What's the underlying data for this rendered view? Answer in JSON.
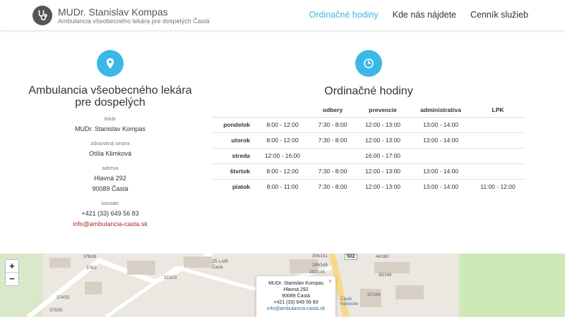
{
  "header": {
    "title": "MUDr. Stanislav Kompas",
    "subtitle": "Ambulancia všeobecného lekára pre dospelých Častá",
    "nav": [
      {
        "label": "Ordinačné hodiny",
        "active": true
      },
      {
        "label": "Kde nás nájdete",
        "active": false
      },
      {
        "label": "Cenník služieb",
        "active": false
      }
    ]
  },
  "colors": {
    "accent": "#3bb7e8",
    "email": "#b02a2a"
  },
  "icons": {
    "logo": "stethoscope-icon",
    "left": "map-marker-icon",
    "right": "clock-icon"
  },
  "contact": {
    "heading": "Ambulancia všeobecného lekára pre dospelých",
    "doctor_label": "lekár",
    "doctor": "MUDr. Stanislav Kompas",
    "nurse_label": "zdravotná sestra",
    "nurse": "Otília Klimková",
    "address_label": "adresa",
    "street": "Hlavná 292",
    "city": "90089 Častá",
    "contact_label": "kontakt",
    "phone": "+421 (33) 649 56 83",
    "email": "info@ambulancia-casta.sk"
  },
  "hours": {
    "title": "Ordinačné hodiny",
    "columns": [
      "",
      "",
      "odbery",
      "prevencie",
      "administratíva",
      "LPK"
    ],
    "rows": [
      {
        "day": "pondelok",
        "cells": [
          "8:00 - 12:00",
          "7:30 - 8:00",
          "12:00 - 13:00",
          "13:00 - 14:00",
          ""
        ]
      },
      {
        "day": "utorok",
        "cells": [
          "8:00 - 12:00",
          "7:30 - 8:00",
          "12:00 - 13:00",
          "13:00 - 14:00",
          ""
        ]
      },
      {
        "day": "streda",
        "cells": [
          "12:00 - 16:00",
          "",
          "16:00 - 17:00",
          "",
          ""
        ]
      },
      {
        "day": "štvrtok",
        "cells": [
          "8:00 - 12:00",
          "7:30 - 8:00",
          "12:00 - 13:00",
          "13:00 - 14:00",
          ""
        ]
      },
      {
        "day": "piatok",
        "cells": [
          "8:00 - 11:00",
          "7:30 - 8:00",
          "12:00 - 13:00",
          "13:00 - 14:00",
          "11:00 - 12:00"
        ]
      }
    ]
  },
  "map": {
    "zoom_in": "+",
    "zoom_out": "−",
    "popup": {
      "close": "×",
      "name": "MUDr. Stanislav Kompas",
      "street": "Hlavná 292",
      "city": "90089 Častá",
      "phone": "+421 (33) 649 56 83",
      "email": "info@ambulancia-casta.sk"
    },
    "labels": [
      "376/26",
      "376/2",
      "323/23",
      "374/32",
      "373/33",
      "ZŠ s MŠ Častá",
      "300/151",
      "299/149",
      "297/145",
      "502",
      "44/160",
      "35/156",
      "37/154",
      "Častá Námestie"
    ]
  }
}
